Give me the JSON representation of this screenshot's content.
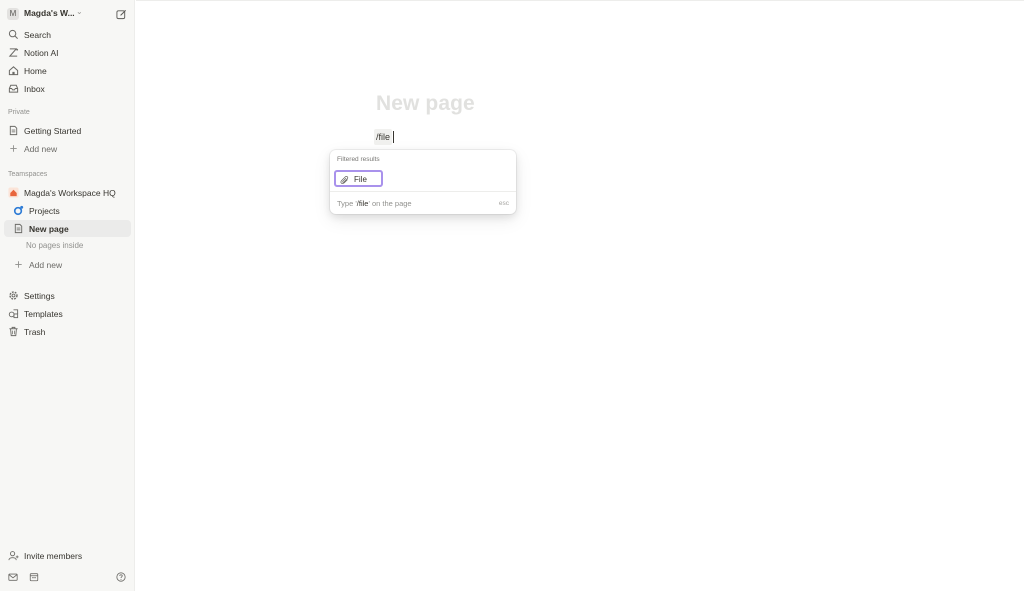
{
  "workspace": {
    "avatar_letter": "M",
    "name": "Magda's W..."
  },
  "nav": {
    "search": "Search",
    "notion_ai": "Notion AI",
    "home": "Home",
    "inbox": "Inbox"
  },
  "private": {
    "label": "Private",
    "getting_started": "Getting Started",
    "add_new": "Add new"
  },
  "teamspaces": {
    "label": "Teamspaces",
    "workspace_hq": "Magda's Workspace HQ",
    "projects": "Projects",
    "new_page": "New page",
    "no_pages": "No pages inside",
    "add_new": "Add new"
  },
  "footer_nav": {
    "settings": "Settings",
    "templates": "Templates",
    "trash": "Trash",
    "invite": "Invite members"
  },
  "page": {
    "title_placeholder": "New page",
    "slash_command": "/file"
  },
  "menu": {
    "header": "Filtered results",
    "item_label": "File",
    "footer_prefix": "Type '",
    "footer_keyword": "/file",
    "footer_suffix": "' on the page",
    "esc": "esc"
  },
  "colors": {
    "sidebar_bg": "#f7f7f5",
    "active_item_bg": "#ebebea",
    "menu_highlight_border": "#a992ec",
    "title_placeholder": "#e1e1df",
    "workspace_icon": "#e8663d",
    "projects_icon": "#2e7cd6"
  }
}
